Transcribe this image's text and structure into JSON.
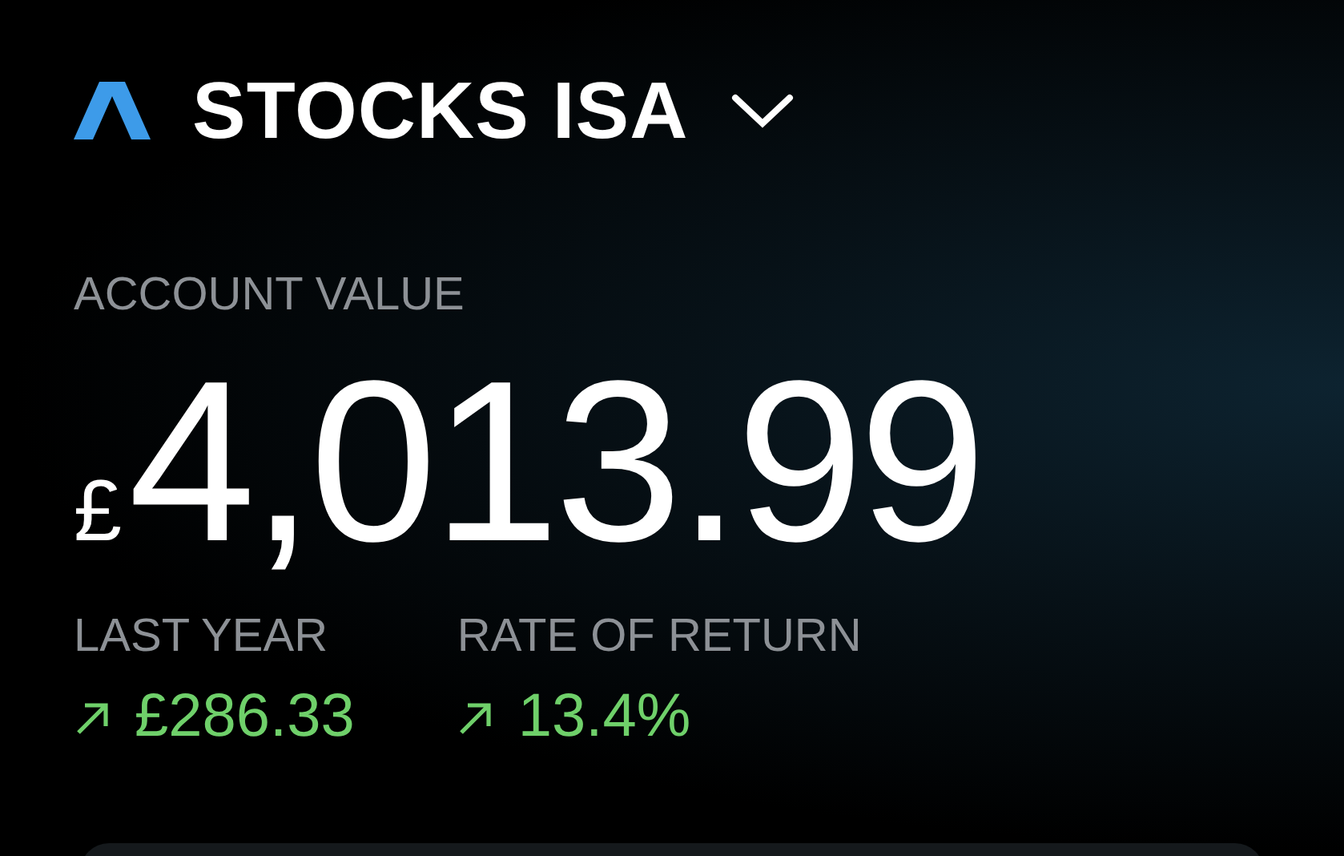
{
  "account": {
    "title": "STOCKS ISA"
  },
  "value": {
    "label": "ACCOUNT VALUE",
    "currency": "£",
    "amount": "4,013.99"
  },
  "stats": [
    {
      "label": "LAST YEAR",
      "value": "£286.33",
      "kind": "gain"
    },
    {
      "label": "RATE OF RETURN",
      "value": "13.4%",
      "kind": "gain"
    }
  ]
}
